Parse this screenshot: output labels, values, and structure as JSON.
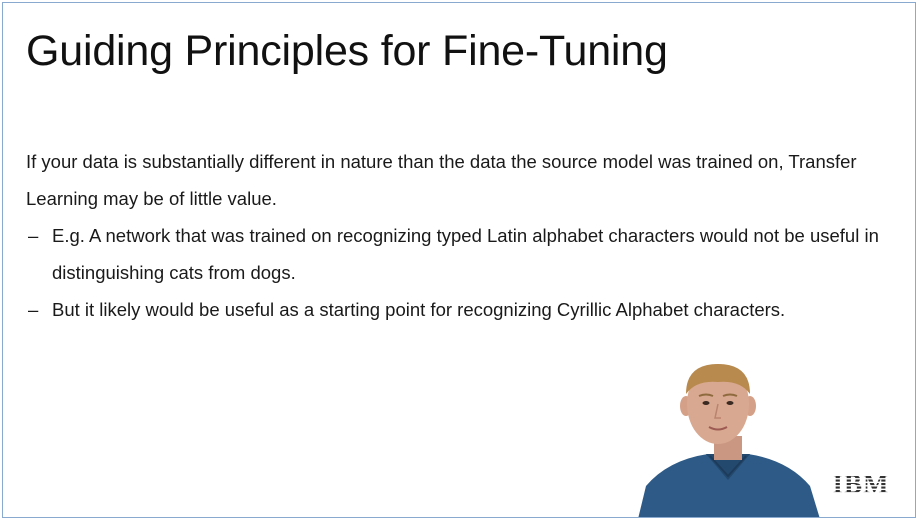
{
  "slide": {
    "title": "Guiding Principles for Fine-Tuning",
    "paragraph": "If your data is substantially different in nature than the data the source model was trained on, Transfer Learning may be of little value.",
    "bullets": [
      {
        "marker": "–",
        "text": "E.g. A network that was trained on recognizing typed Latin alphabet characters would not be useful in distinguishing cats from dogs."
      },
      {
        "marker": "–",
        "text": "But it likely would be useful as a starting point for recognizing Cyrillic Alphabet characters."
      }
    ]
  },
  "branding": {
    "logo_text": "IBM",
    "logo_color": "#333333"
  },
  "colors": {
    "frame_border": "#8aa9cf",
    "shirt": "#2d5a86",
    "skin": "#d9a890",
    "hair": "#b88a4e"
  }
}
